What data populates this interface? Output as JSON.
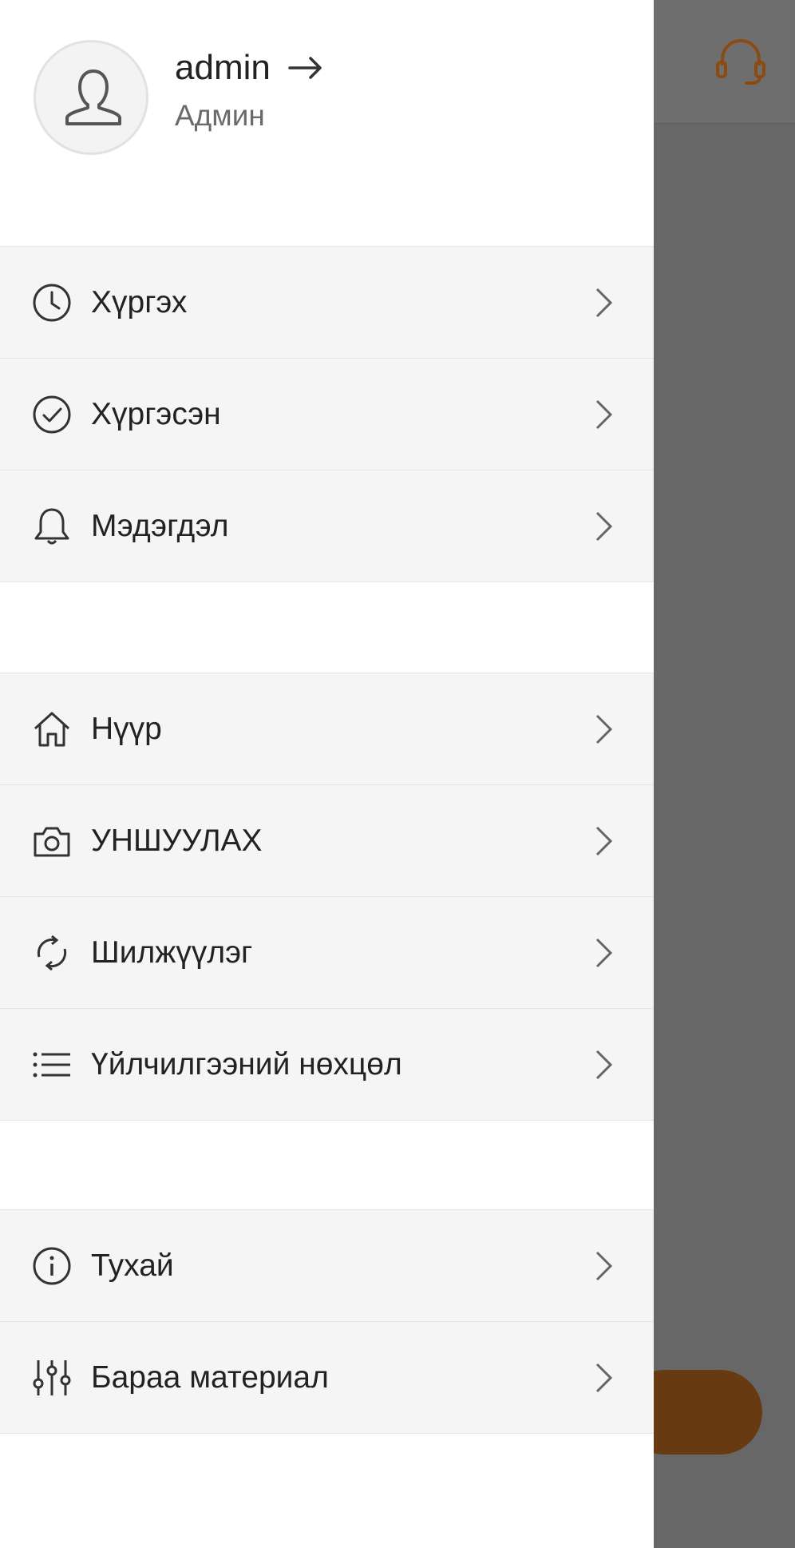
{
  "profile": {
    "username": "admin",
    "role": "Админ"
  },
  "menu_group_1": [
    {
      "label": "Хүргэх",
      "icon": "clock-icon"
    },
    {
      "label": "Хүргэсэн",
      "icon": "check-circle-icon"
    },
    {
      "label": "Мэдэгдэл",
      "icon": "bell-icon"
    }
  ],
  "menu_group_2": [
    {
      "label": "Нүүр",
      "icon": "home-icon"
    },
    {
      "label": "УНШУУЛАХ",
      "icon": "camera-icon"
    },
    {
      "label": "Шилжүүлэг",
      "icon": "refresh-icon"
    },
    {
      "label": "Үйлчилгээний нөхцөл",
      "icon": "list-icon"
    }
  ],
  "menu_group_3": [
    {
      "label": "Тухай",
      "icon": "info-icon"
    },
    {
      "label": "Бараа материал",
      "icon": "sliders-icon"
    }
  ],
  "colors": {
    "accent": "#8a4b12",
    "overlay": "#676767"
  }
}
